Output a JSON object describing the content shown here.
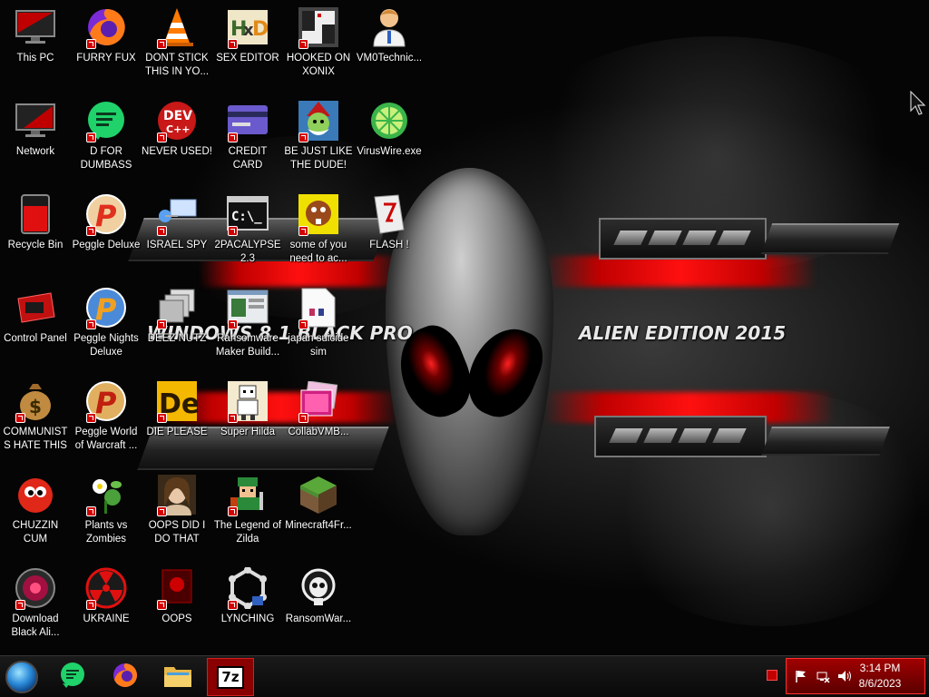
{
  "desktop": {
    "wallpaper": {
      "text_top": "WINDOWS 8.1 BLACK PRO",
      "text_right": "ALIEN EDITION 2015"
    },
    "icons": [
      {
        "label": "This PC",
        "icon": "monitor-icon"
      },
      {
        "label": "FURRY FUX",
        "icon": "firefox-icon"
      },
      {
        "label": "DONT STICK THIS IN YO...",
        "icon": "traffic-cone-icon"
      },
      {
        "label": "SEX EDITOR",
        "icon": "hxd-hex-editor-icon"
      },
      {
        "label": "HOOKED ON XONIX",
        "icon": "xonix-game-icon"
      },
      {
        "label": "VM0Technic...",
        "icon": "doctor-user-icon"
      },
      {
        "label": "Network",
        "icon": "network-icon"
      },
      {
        "label": "D FOR DUMBASS",
        "icon": "chat-bubble-icon"
      },
      {
        "label": "NEVER USED!",
        "icon": "dev-cpp-icon"
      },
      {
        "label": "CREDIT CARD CHECKER",
        "icon": "credit-card-icon"
      },
      {
        "label": "BE JUST LIKE THE DUDE!",
        "icon": "elf-santa-icon"
      },
      {
        "label": "VirusWire.exe",
        "icon": "lime-icon"
      },
      {
        "label": "Recycle Bin",
        "icon": "recycle-bin-icon"
      },
      {
        "label": "Peggle Deluxe",
        "icon": "peggle-icon"
      },
      {
        "label": "ISRAEL SPY",
        "icon": "network-spy-icon"
      },
      {
        "label": "2PACALYPSE 2.3",
        "icon": "terminal-icon"
      },
      {
        "label": "some of you need to ac...",
        "icon": "beaver-icon"
      },
      {
        "label": "FLASH !",
        "icon": "flash-icon"
      },
      {
        "label": "Control Panel",
        "icon": "control-panel-icon"
      },
      {
        "label": "Peggle Nights Deluxe",
        "icon": "peggle-icon"
      },
      {
        "label": "DEEZ NUTZ",
        "icon": "windows-stack-icon"
      },
      {
        "label": "Ransomware Maker Build...",
        "icon": "app-window-icon"
      },
      {
        "label": "japan suicide sim",
        "icon": "document-icon"
      },
      {
        "label": "COMMUNISTS HATE THIS G...",
        "icon": "money-bag-icon"
      },
      {
        "label": "Peggle World of Warcraft ...",
        "icon": "peggle-icon"
      },
      {
        "label": "DIE PLEASE",
        "icon": "de-icon"
      },
      {
        "label": "Super Hilda",
        "icon": "pixel-character-icon"
      },
      {
        "label": "CollabVMB...",
        "icon": "video-player-icon"
      },
      {
        "label": "CHUZZIN CUM",
        "icon": "chuzzle-icon"
      },
      {
        "label": "Plants vs Zombies",
        "icon": "plant-icon"
      },
      {
        "label": "OOPS DID I DO THAT",
        "icon": "portrait-icon"
      },
      {
        "label": "The Legend of Zilda",
        "icon": "pixel-hero-icon"
      },
      {
        "label": "Minecraft4Fr...",
        "icon": "grass-block-icon"
      },
      {
        "label": "Download Black Ali...",
        "icon": "alien-orb-icon"
      },
      {
        "label": "UKRAINE",
        "icon": "radiation-icon"
      },
      {
        "label": "OOPS",
        "icon": "red-screen-icon"
      },
      {
        "label": "LYNCHING",
        "icon": "network-nodes-icon"
      },
      {
        "label": "RansomWar...",
        "icon": "skull-icon"
      }
    ]
  },
  "taskbar": {
    "pinned": [
      {
        "icon": "start-orb-icon"
      },
      {
        "icon": "chat-bubble-icon"
      },
      {
        "icon": "firefox-icon"
      },
      {
        "icon": "file-explorer-icon"
      },
      {
        "icon": "7zip-icon",
        "label": "7z",
        "active": true
      }
    ],
    "clock": {
      "time": "3:14 PM",
      "date": "8/6/2023"
    },
    "accent_color": "#a00000"
  }
}
